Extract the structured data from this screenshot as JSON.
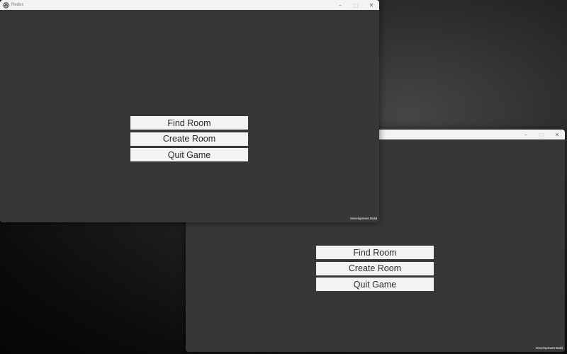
{
  "window_front": {
    "title": "Redec",
    "caption": {
      "minimize": "–",
      "maximize": "□",
      "close": "✕"
    },
    "menu": {
      "find_room": "Find Room",
      "create_room": "Create Room",
      "quit_game": "Quit Game"
    },
    "footer": "Development Build"
  },
  "window_back": {
    "title": "",
    "caption": {
      "minimize": "–",
      "maximize": "□",
      "close": "✕"
    },
    "menu": {
      "find_room": "Find Room",
      "create_room": "Create Room",
      "quit_game": "Quit Game"
    },
    "footer": "Development Build"
  },
  "colors": {
    "window_bg": "#383639",
    "titlebar_bg": "#f3f3f3",
    "button_bg": "#f4f2f5",
    "button_text": "#2a2a2a",
    "desktop_bg": "#1a1a1a"
  },
  "icons": {
    "app_icon": "unity-logo-icon",
    "minimize": "minimize-icon",
    "maximize": "maximize-icon",
    "close": "close-icon"
  }
}
